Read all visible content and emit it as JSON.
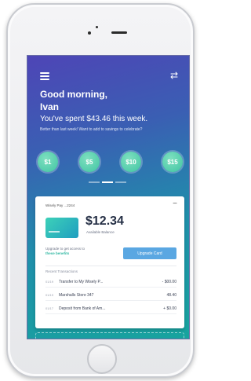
{
  "header": {
    "greeting_line1": "Good morning,",
    "greeting_line2": "Ivan",
    "spent": "You've spent $43.46 this week.",
    "hint": "Better than last week! Want to add to savings to celebrate?"
  },
  "amounts": [
    "$1",
    "$5",
    "$10",
    "$15"
  ],
  "card": {
    "account": "Wisely Pay ...2244",
    "balance": "$12.34",
    "balance_label": "Available Balance",
    "upgrade_text": "Upgrade to get access to",
    "upgrade_link": "these benefits",
    "upgrade_button": "Upgrade Card",
    "recent_label": "Recent Transactions",
    "transactions": [
      {
        "date": "01/19",
        "desc": "Transfer to My Wisely P...",
        "amount": "- $00.00"
      },
      {
        "date": "01/19",
        "desc": "Marshalls Store 347",
        "amount": "48.40"
      },
      {
        "date": "01/17",
        "desc": "Deposit from Bank of Am...",
        "amount": "+ $0.00"
      }
    ]
  },
  "colors": {
    "accent": "#40c4a2",
    "button": "#5aa7e2",
    "gradient_top": "#4e45b6",
    "gradient_bottom": "#17a49e"
  },
  "icons": [
    "menu-icon",
    "link-icon",
    "collapse-icon"
  ]
}
